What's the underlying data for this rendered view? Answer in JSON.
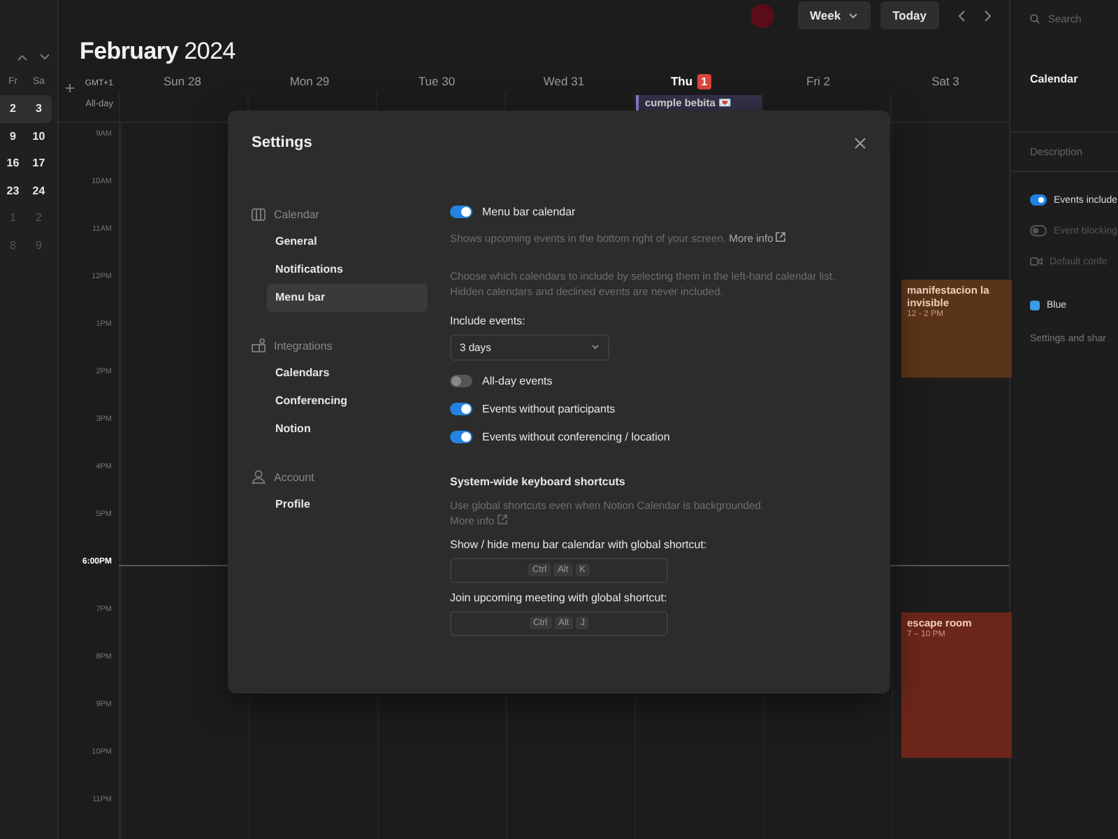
{
  "mini_calendar": {
    "weekdays": [
      "Fr",
      "Sa"
    ],
    "weeks": [
      {
        "days": [
          "2",
          "3"
        ],
        "selected": true,
        "muted": false
      },
      {
        "days": [
          "9",
          "10"
        ],
        "selected": false,
        "muted": false
      },
      {
        "days": [
          "16",
          "17"
        ],
        "selected": false,
        "muted": false
      },
      {
        "days": [
          "23",
          "24"
        ],
        "selected": false,
        "muted": false
      },
      {
        "days": [
          "1",
          "2"
        ],
        "selected": false,
        "muted": true
      },
      {
        "days": [
          "8",
          "9"
        ],
        "selected": false,
        "muted": true
      }
    ]
  },
  "header": {
    "month": "February",
    "year": "2024",
    "view_button": "Week",
    "today_button": "Today"
  },
  "week": {
    "timezone": "GMT+1",
    "all_day_label": "All-day",
    "days": [
      {
        "label": "Sun 28",
        "today": false
      },
      {
        "label": "Mon 29",
        "today": false
      },
      {
        "label": "Tue 30",
        "today": false
      },
      {
        "label": "Wed 31",
        "today": false
      },
      {
        "label": "Thu",
        "badge": "1",
        "today": true,
        "all_day_events": [
          {
            "title": "cumple bebita 💌",
            "color": "#8a7fd0"
          }
        ]
      },
      {
        "label": "Fri 2",
        "today": false
      },
      {
        "label": "Sat 3",
        "today": false,
        "events": [
          {
            "title": "manifestacion la invisible",
            "time": "12 - 2 PM",
            "color": "#5a3419"
          },
          {
            "title": "escape room",
            "time": "7 – 10 PM",
            "color": "#6b2619"
          }
        ]
      }
    ],
    "hours": [
      {
        "label": "9AM",
        "current": false
      },
      {
        "label": "10AM",
        "current": false
      },
      {
        "label": "11AM",
        "current": false
      },
      {
        "label": "12PM",
        "current": false
      },
      {
        "label": "1PM",
        "current": false
      },
      {
        "label": "2PM",
        "current": false
      },
      {
        "label": "3PM",
        "current": false
      },
      {
        "label": "4PM",
        "current": false
      },
      {
        "label": "5PM",
        "current": false
      },
      {
        "label": "6:00PM",
        "current": true
      },
      {
        "label": "7PM",
        "current": false
      },
      {
        "label": "8PM",
        "current": false
      },
      {
        "label": "9PM",
        "current": false
      },
      {
        "label": "10PM",
        "current": false
      },
      {
        "label": "11PM",
        "current": false
      }
    ]
  },
  "right_panel": {
    "search": {
      "placeholder": "Search"
    },
    "title": "Calendar",
    "description": {
      "placeholder": "Description"
    },
    "options": [
      {
        "kind": "toggle",
        "label": "Events include",
        "on": true
      },
      {
        "kind": "toggle",
        "label": "Event blocking",
        "on": false
      },
      {
        "kind": "video",
        "label": "Default confe",
        "on": false
      }
    ],
    "color_option": {
      "label": "Blue",
      "color": "#3b9be0"
    },
    "footer": "Settings and shar"
  },
  "settings": {
    "title": "Settings",
    "nav": [
      {
        "section": "Calendar",
        "items": [
          {
            "label": "General",
            "selected": false
          },
          {
            "label": "Notifications",
            "selected": false
          },
          {
            "label": "Menu bar",
            "selected": true
          }
        ]
      },
      {
        "section": "Integrations",
        "items": [
          {
            "label": "Calendars",
            "selected": false
          },
          {
            "label": "Conferencing",
            "selected": false
          },
          {
            "label": "Notion",
            "selected": false
          }
        ]
      },
      {
        "section": "Account",
        "items": [
          {
            "label": "Profile",
            "selected": false
          }
        ]
      }
    ],
    "main_toggle": {
      "label": "Menu bar calendar",
      "on": true
    },
    "main_description": "Shows upcoming events in the bottom right of your screen.",
    "main_link": "More info",
    "note": "Choose which calendars to include by selecting them in the left-hand calendar list. Hidden calendars and declined events are never included.",
    "include_label": "Include events:",
    "include_value": "3 days",
    "toggles": [
      {
        "label": "All-day events",
        "on": false
      },
      {
        "label": "Events without participants",
        "on": true
      },
      {
        "label": "Events without conferencing / location",
        "on": true
      }
    ],
    "shortcuts_title": "System-wide keyboard shortcuts",
    "shortcuts_description": "Use global shortcuts even when Notion Calendar is backgrounded.",
    "shortcuts_link": "More info",
    "shortcuts": [
      {
        "label": "Show / hide menu bar calendar with global shortcut:",
        "keys": [
          "Ctrl",
          "Alt",
          "K"
        ]
      },
      {
        "label": "Join upcoming meeting with global shortcut:",
        "keys": [
          "Ctrl",
          "Alt",
          "J"
        ]
      }
    ]
  }
}
